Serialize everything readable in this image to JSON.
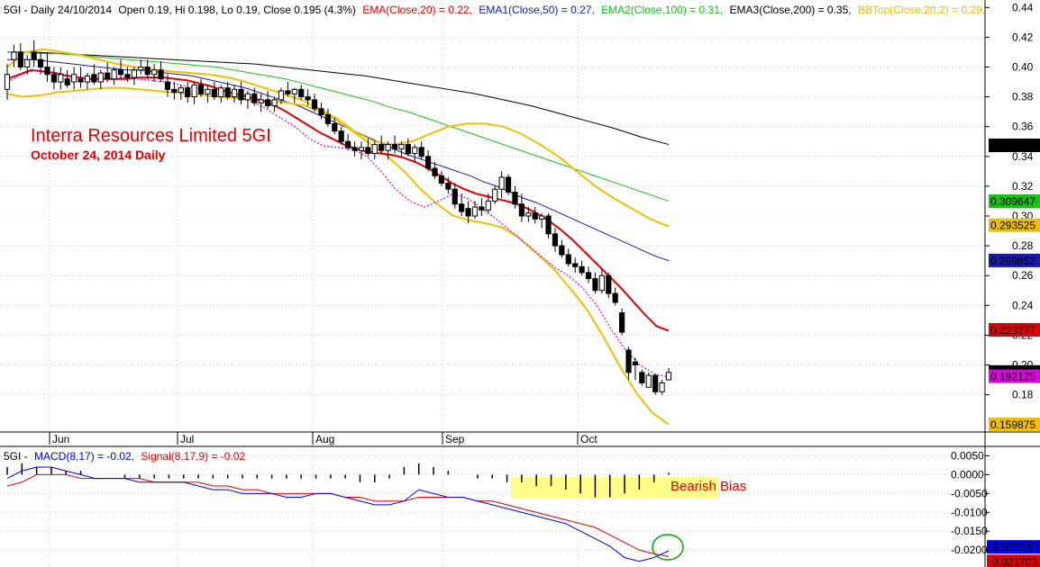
{
  "header": {
    "symbol": "5GI - Daily 24/10/2014",
    "ohlc": "Open 0.19, Hi 0.198, Lo 0.19, Close 0.195 (4.3%)",
    "ema20": "EMA(Close,20) = 0.22,",
    "ema50": "EMA1(Close,50) = 0.27,",
    "ema100": "EMA2(Close,100) = 0.31,",
    "ema200": "EMA3(Close,200) = 0.35,",
    "bbtop": "BBTop(Close,20,2) = 0.29,"
  },
  "annotations": {
    "title": "Interra Resources Limited 5GI",
    "subtitle": "October 24, 2014 Daily",
    "bias": "Bearish Bias"
  },
  "macd_header": {
    "symbol": "5GI -",
    "macd": "MACD(8,17) = -0.02,",
    "signal": "Signal(8,17,9) = -0.02"
  },
  "colors": {
    "ema20": "#e00000",
    "ema50": "#1a1aa6",
    "ema100": "#18c018",
    "ema200": "#000000",
    "bband": "#f0c000",
    "ema_short": "#d000d0",
    "macd": "#0000e0",
    "signal": "#e00000",
    "highlight": "#ffff88",
    "circle": "#00a000",
    "annotation": "#e00000"
  },
  "chart_data": [
    {
      "type": "candlestick",
      "x_ticks": [
        "Jun",
        "Jul",
        "Aug",
        "Sep",
        "Oct"
      ],
      "y_ticks": [
        "0.44",
        "0.42",
        "0.40",
        "0.38",
        "0.36",
        "0.34",
        "0.32",
        "0.30",
        "0.28",
        "0.26",
        "0.24",
        "0.22",
        "0.20",
        "0.18"
      ],
      "ylim": [
        0.155,
        0.445
      ],
      "candles": [
        {
          "o": 0.385,
          "h": 0.402,
          "l": 0.378,
          "c": 0.395
        },
        {
          "o": 0.405,
          "h": 0.415,
          "l": 0.4,
          "c": 0.41
        },
        {
          "o": 0.41,
          "h": 0.416,
          "l": 0.398,
          "c": 0.4
        },
        {
          "o": 0.4,
          "h": 0.408,
          "l": 0.395,
          "c": 0.405
        },
        {
          "o": 0.41,
          "h": 0.418,
          "l": 0.4,
          "c": 0.405
        },
        {
          "o": 0.405,
          "h": 0.41,
          "l": 0.395,
          "c": 0.4
        },
        {
          "o": 0.4,
          "h": 0.41,
          "l": 0.39,
          "c": 0.395
        },
        {
          "o": 0.395,
          "h": 0.4,
          "l": 0.385,
          "c": 0.39
        },
        {
          "o": 0.39,
          "h": 0.4,
          "l": 0.385,
          "c": 0.395
        },
        {
          "o": 0.392,
          "h": 0.398,
          "l": 0.386,
          "c": 0.388
        },
        {
          "o": 0.39,
          "h": 0.4,
          "l": 0.385,
          "c": 0.395
        },
        {
          "o": 0.392,
          "h": 0.4,
          "l": 0.386,
          "c": 0.39
        },
        {
          "o": 0.39,
          "h": 0.396,
          "l": 0.385,
          "c": 0.394
        },
        {
          "o": 0.395,
          "h": 0.402,
          "l": 0.388,
          "c": 0.39
        },
        {
          "o": 0.39,
          "h": 0.398,
          "l": 0.385,
          "c": 0.396
        },
        {
          "o": 0.396,
          "h": 0.403,
          "l": 0.39,
          "c": 0.392
        },
        {
          "o": 0.392,
          "h": 0.4,
          "l": 0.388,
          "c": 0.398
        },
        {
          "o": 0.398,
          "h": 0.405,
          "l": 0.392,
          "c": 0.395
        },
        {
          "o": 0.395,
          "h": 0.4,
          "l": 0.39,
          "c": 0.393
        },
        {
          "o": 0.393,
          "h": 0.4,
          "l": 0.388,
          "c": 0.398
        },
        {
          "o": 0.398,
          "h": 0.405,
          "l": 0.395,
          "c": 0.4
        },
        {
          "o": 0.4,
          "h": 0.405,
          "l": 0.392,
          "c": 0.395
        },
        {
          "o": 0.395,
          "h": 0.402,
          "l": 0.39,
          "c": 0.398
        },
        {
          "o": 0.398,
          "h": 0.404,
          "l": 0.39,
          "c": 0.392
        },
        {
          "o": 0.39,
          "h": 0.395,
          "l": 0.38,
          "c": 0.385
        },
        {
          "o": 0.385,
          "h": 0.39,
          "l": 0.378,
          "c": 0.383
        },
        {
          "o": 0.383,
          "h": 0.388,
          "l": 0.378,
          "c": 0.386
        },
        {
          "o": 0.386,
          "h": 0.39,
          "l": 0.376,
          "c": 0.38
        },
        {
          "o": 0.38,
          "h": 0.39,
          "l": 0.375,
          "c": 0.388
        },
        {
          "o": 0.388,
          "h": 0.392,
          "l": 0.38,
          "c": 0.382
        },
        {
          "o": 0.382,
          "h": 0.388,
          "l": 0.376,
          "c": 0.385
        },
        {
          "o": 0.385,
          "h": 0.39,
          "l": 0.378,
          "c": 0.38
        },
        {
          "o": 0.38,
          "h": 0.388,
          "l": 0.376,
          "c": 0.386
        },
        {
          "o": 0.386,
          "h": 0.39,
          "l": 0.378,
          "c": 0.38
        },
        {
          "o": 0.38,
          "h": 0.388,
          "l": 0.376,
          "c": 0.385
        },
        {
          "o": 0.385,
          "h": 0.39,
          "l": 0.375,
          "c": 0.378
        },
        {
          "o": 0.378,
          "h": 0.384,
          "l": 0.372,
          "c": 0.382
        },
        {
          "o": 0.382,
          "h": 0.386,
          "l": 0.374,
          "c": 0.376
        },
        {
          "o": 0.376,
          "h": 0.382,
          "l": 0.37,
          "c": 0.378
        },
        {
          "o": 0.378,
          "h": 0.384,
          "l": 0.372,
          "c": 0.374
        },
        {
          "o": 0.374,
          "h": 0.38,
          "l": 0.37,
          "c": 0.378
        },
        {
          "o": 0.378,
          "h": 0.386,
          "l": 0.375,
          "c": 0.384
        },
        {
          "o": 0.384,
          "h": 0.39,
          "l": 0.38,
          "c": 0.382
        },
        {
          "o": 0.382,
          "h": 0.386,
          "l": 0.376,
          "c": 0.385
        },
        {
          "o": 0.385,
          "h": 0.388,
          "l": 0.378,
          "c": 0.38
        },
        {
          "o": 0.38,
          "h": 0.385,
          "l": 0.374,
          "c": 0.378
        },
        {
          "o": 0.378,
          "h": 0.382,
          "l": 0.37,
          "c": 0.372
        },
        {
          "o": 0.372,
          "h": 0.376,
          "l": 0.365,
          "c": 0.368
        },
        {
          "o": 0.368,
          "h": 0.372,
          "l": 0.36,
          "c": 0.362
        },
        {
          "o": 0.362,
          "h": 0.366,
          "l": 0.355,
          "c": 0.357
        },
        {
          "o": 0.357,
          "h": 0.36,
          "l": 0.348,
          "c": 0.35
        },
        {
          "o": 0.35,
          "h": 0.355,
          "l": 0.344,
          "c": 0.346
        },
        {
          "o": 0.346,
          "h": 0.35,
          "l": 0.34,
          "c": 0.344
        },
        {
          "o": 0.344,
          "h": 0.35,
          "l": 0.338,
          "c": 0.346
        },
        {
          "o": 0.346,
          "h": 0.352,
          "l": 0.34,
          "c": 0.342
        },
        {
          "o": 0.342,
          "h": 0.35,
          "l": 0.338,
          "c": 0.348
        },
        {
          "o": 0.348,
          "h": 0.354,
          "l": 0.342,
          "c": 0.344
        },
        {
          "o": 0.344,
          "h": 0.35,
          "l": 0.338,
          "c": 0.348
        },
        {
          "o": 0.348,
          "h": 0.354,
          "l": 0.342,
          "c": 0.345
        },
        {
          "o": 0.345,
          "h": 0.35,
          "l": 0.34,
          "c": 0.348
        },
        {
          "o": 0.348,
          "h": 0.352,
          "l": 0.34,
          "c": 0.342
        },
        {
          "o": 0.342,
          "h": 0.348,
          "l": 0.336,
          "c": 0.346
        },
        {
          "o": 0.346,
          "h": 0.35,
          "l": 0.338,
          "c": 0.34
        },
        {
          "o": 0.34,
          "h": 0.344,
          "l": 0.33,
          "c": 0.332
        },
        {
          "o": 0.332,
          "h": 0.336,
          "l": 0.325,
          "c": 0.327
        },
        {
          "o": 0.327,
          "h": 0.33,
          "l": 0.32,
          "c": 0.322
        },
        {
          "o": 0.322,
          "h": 0.326,
          "l": 0.315,
          "c": 0.318
        },
        {
          "o": 0.318,
          "h": 0.322,
          "l": 0.305,
          "c": 0.308
        },
        {
          "o": 0.308,
          "h": 0.315,
          "l": 0.3,
          "c": 0.303
        },
        {
          "o": 0.305,
          "h": 0.31,
          "l": 0.295,
          "c": 0.3
        },
        {
          "o": 0.3,
          "h": 0.31,
          "l": 0.298,
          "c": 0.306
        },
        {
          "o": 0.306,
          "h": 0.312,
          "l": 0.3,
          "c": 0.304
        },
        {
          "o": 0.304,
          "h": 0.315,
          "l": 0.302,
          "c": 0.31
        },
        {
          "o": 0.31,
          "h": 0.32,
          "l": 0.308,
          "c": 0.318
        },
        {
          "o": 0.318,
          "h": 0.33,
          "l": 0.312,
          "c": 0.326
        },
        {
          "o": 0.326,
          "h": 0.328,
          "l": 0.314,
          "c": 0.316
        },
        {
          "o": 0.316,
          "h": 0.32,
          "l": 0.305,
          "c": 0.308
        },
        {
          "o": 0.308,
          "h": 0.315,
          "l": 0.296,
          "c": 0.3
        },
        {
          "o": 0.3,
          "h": 0.306,
          "l": 0.296,
          "c": 0.302
        },
        {
          "o": 0.302,
          "h": 0.306,
          "l": 0.295,
          "c": 0.298
        },
        {
          "o": 0.298,
          "h": 0.302,
          "l": 0.292,
          "c": 0.3
        },
        {
          "o": 0.3,
          "h": 0.302,
          "l": 0.285,
          "c": 0.288
        },
        {
          "o": 0.288,
          "h": 0.292,
          "l": 0.276,
          "c": 0.28
        },
        {
          "o": 0.28,
          "h": 0.284,
          "l": 0.272,
          "c": 0.274
        },
        {
          "o": 0.274,
          "h": 0.278,
          "l": 0.266,
          "c": 0.268
        },
        {
          "o": 0.268,
          "h": 0.272,
          "l": 0.262,
          "c": 0.266
        },
        {
          "o": 0.266,
          "h": 0.27,
          "l": 0.26,
          "c": 0.262
        },
        {
          "o": 0.262,
          "h": 0.266,
          "l": 0.255,
          "c": 0.258
        },
        {
          "o": 0.258,
          "h": 0.262,
          "l": 0.248,
          "c": 0.25
        },
        {
          "o": 0.25,
          "h": 0.265,
          "l": 0.248,
          "c": 0.26
        },
        {
          "o": 0.26,
          "h": 0.262,
          "l": 0.245,
          "c": 0.248
        },
        {
          "o": 0.248,
          "h": 0.252,
          "l": 0.24,
          "c": 0.242
        },
        {
          "o": 0.235,
          "h": 0.238,
          "l": 0.22,
          "c": 0.222
        },
        {
          "o": 0.21,
          "h": 0.212,
          "l": 0.19,
          "c": 0.195
        },
        {
          "o": 0.202,
          "h": 0.205,
          "l": 0.19,
          "c": 0.2
        },
        {
          "o": 0.195,
          "h": 0.197,
          "l": 0.186,
          "c": 0.188
        },
        {
          "o": 0.185,
          "h": 0.195,
          "l": 0.185,
          "c": 0.193
        },
        {
          "o": 0.193,
          "h": 0.194,
          "l": 0.18,
          "c": 0.182
        },
        {
          "o": 0.182,
          "h": 0.19,
          "l": 0.18,
          "c": 0.188
        },
        {
          "o": 0.19,
          "h": 0.198,
          "l": 0.19,
          "c": 0.195
        }
      ],
      "lines": {
        "ema20": [
          0.392,
          0.395,
          0.398,
          0.397,
          0.396,
          0.394,
          0.393,
          0.392,
          0.392,
          0.392,
          0.392,
          0.393,
          0.393,
          0.393,
          0.392,
          0.391,
          0.389,
          0.387,
          0.384,
          0.382,
          0.38,
          0.378,
          0.375,
          0.371,
          0.366,
          0.361,
          0.356,
          0.352,
          0.348,
          0.345,
          0.343,
          0.342,
          0.341,
          0.339,
          0.336,
          0.332,
          0.327,
          0.322,
          0.318,
          0.315,
          0.313,
          0.311,
          0.309,
          0.306,
          0.302,
          0.297,
          0.291,
          0.284,
          0.276,
          0.268,
          0.26,
          0.252,
          0.243,
          0.234,
          0.226,
          0.223
        ],
        "ema50": [
          0.405,
          0.405,
          0.405,
          0.404,
          0.403,
          0.402,
          0.401,
          0.4,
          0.399,
          0.398,
          0.398,
          0.397,
          0.396,
          0.395,
          0.394,
          0.392,
          0.39,
          0.388,
          0.386,
          0.383,
          0.38,
          0.377,
          0.374,
          0.37,
          0.366,
          0.362,
          0.358,
          0.354,
          0.35,
          0.346,
          0.342,
          0.339,
          0.336,
          0.333,
          0.33,
          0.327,
          0.323,
          0.32,
          0.316,
          0.312,
          0.309,
          0.305,
          0.301,
          0.297,
          0.293,
          0.289,
          0.285,
          0.281,
          0.277,
          0.273,
          0.27
        ],
        "ema100": [
          0.41,
          0.41,
          0.409,
          0.409,
          0.408,
          0.407,
          0.406,
          0.405,
          0.404,
          0.403,
          0.402,
          0.401,
          0.4,
          0.398,
          0.396,
          0.394,
          0.392,
          0.389,
          0.386,
          0.383,
          0.38,
          0.377,
          0.373,
          0.37,
          0.366,
          0.362,
          0.358,
          0.354,
          0.35,
          0.346,
          0.342,
          0.338,
          0.334,
          0.33,
          0.326,
          0.322,
          0.318,
          0.314,
          0.31
        ],
        "ema200": [
          0.41,
          0.41,
          0.409,
          0.408,
          0.407,
          0.406,
          0.405,
          0.404,
          0.403,
          0.402,
          0.4,
          0.398,
          0.396,
          0.394,
          0.391,
          0.388,
          0.385,
          0.382,
          0.378,
          0.374,
          0.369,
          0.364,
          0.359,
          0.353,
          0.348
        ],
        "bb_top": [
          0.4,
          0.41,
          0.412,
          0.41,
          0.408,
          0.405,
          0.402,
          0.4,
          0.398,
          0.397,
          0.396,
          0.395,
          0.393,
          0.39,
          0.386,
          0.382,
          0.378,
          0.372,
          0.365,
          0.356,
          0.35,
          0.348,
          0.35,
          0.355,
          0.36,
          0.362,
          0.362,
          0.36,
          0.355,
          0.348,
          0.34,
          0.33,
          0.32,
          0.312,
          0.305,
          0.298,
          0.293
        ],
        "bb_bottom": [
          0.382,
          0.38,
          0.381,
          0.383,
          0.384,
          0.385,
          0.386,
          0.386,
          0.385,
          0.384,
          0.383,
          0.382,
          0.381,
          0.38,
          0.379,
          0.378,
          0.377,
          0.376,
          0.374,
          0.37,
          0.364,
          0.356,
          0.348,
          0.34,
          0.33,
          0.318,
          0.308,
          0.3,
          0.297,
          0.295,
          0.292,
          0.285,
          0.275,
          0.265,
          0.252,
          0.238,
          0.22,
          0.2,
          0.182,
          0.168,
          0.16
        ],
        "ema_short": [
          0.39,
          0.395,
          0.398,
          0.397,
          0.395,
          0.393,
          0.392,
          0.392,
          0.393,
          0.392,
          0.391,
          0.39,
          0.388,
          0.386,
          0.384,
          0.382,
          0.38,
          0.377,
          0.372,
          0.366,
          0.36,
          0.352,
          0.347,
          0.346,
          0.345,
          0.34,
          0.33,
          0.318,
          0.31,
          0.306,
          0.31,
          0.315,
          0.312,
          0.305,
          0.298,
          0.29,
          0.282,
          0.274,
          0.266,
          0.26,
          0.252,
          0.24,
          0.224,
          0.21,
          0.2,
          0.194,
          0.192
        ]
      },
      "right_labels": [
        "0.347142",
        "0.309647",
        "0.293525",
        "0.269852",
        "0.223277",
        "0.195",
        "0.192125",
        "0.159875"
      ]
    },
    {
      "type": "macd",
      "y_ticks": [
        "0.0050",
        "0.0000",
        "-0.0050",
        "-0.0100",
        "-0.0150",
        "-0.0200"
      ],
      "ylim": [
        -0.0245,
        0.0075
      ],
      "macd": [
        -0.001,
        0.001,
        0.002,
        0.002,
        0.001,
        0.0,
        -0.001,
        -0.001,
        -0.001,
        -0.002,
        -0.002,
        -0.002,
        -0.002,
        -0.003,
        -0.004,
        -0.004,
        -0.005,
        -0.005,
        -0.005,
        -0.006,
        -0.006,
        -0.005,
        -0.005,
        -0.006,
        -0.007,
        -0.008,
        -0.008,
        -0.007,
        -0.004,
        -0.005,
        -0.006,
        -0.006,
        -0.007,
        -0.008,
        -0.009,
        -0.01,
        -0.011,
        -0.012,
        -0.013,
        -0.015,
        -0.017,
        -0.019,
        -0.022,
        -0.023,
        -0.022,
        -0.0202
      ],
      "signal": [
        -0.003,
        -0.002,
        0.0,
        0.0,
        0.0,
        -0.001,
        -0.001,
        -0.001,
        -0.001,
        -0.001,
        -0.002,
        -0.002,
        -0.002,
        -0.002,
        -0.003,
        -0.003,
        -0.004,
        -0.004,
        -0.005,
        -0.005,
        -0.005,
        -0.005,
        -0.005,
        -0.006,
        -0.006,
        -0.007,
        -0.007,
        -0.007,
        -0.006,
        -0.006,
        -0.006,
        -0.006,
        -0.007,
        -0.007,
        -0.008,
        -0.009,
        -0.01,
        -0.011,
        -0.012,
        -0.013,
        -0.014,
        -0.016,
        -0.018,
        -0.02,
        -0.021,
        -0.0217
      ],
      "hist": [
        0.002,
        0.003,
        0.002,
        0.002,
        0.001,
        0.001,
        0.0,
        0.0,
        -0.001,
        -0.001,
        -0.001,
        -0.001,
        -0.001,
        -0.001,
        -0.001,
        -0.001,
        -0.001,
        -0.001,
        -0.001,
        -0.001,
        -0.001,
        -0.001,
        -0.001,
        -0.001,
        -0.002,
        -0.002,
        -0.001,
        0.002,
        0.003,
        0.002,
        0.001,
        0.0,
        -0.001,
        -0.001,
        -0.002,
        -0.002,
        -0.003,
        -0.003,
        -0.004,
        -0.005,
        -0.006,
        -0.006,
        -0.005,
        -0.004,
        -0.002,
        0.0005
      ],
      "right_labels": [
        "-0.020240",
        "-0.021703"
      ]
    }
  ]
}
